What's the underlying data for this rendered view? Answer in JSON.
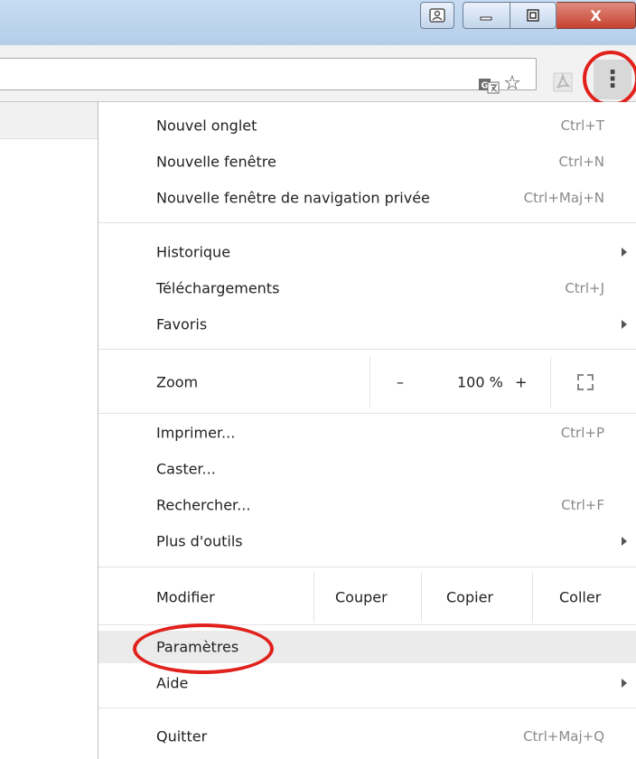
{
  "window": {
    "controls": {
      "profile": "profile-icon",
      "minimize": "minimize-icon",
      "restore": "restore-icon",
      "close": "close-icon",
      "close_glyph": "X"
    }
  },
  "toolbar": {
    "icons": [
      "translate-icon",
      "star-icon",
      "pdf-icon",
      "menu-icon"
    ],
    "star_glyph": "☆",
    "menu_glyph": "⋮"
  },
  "menu": {
    "group1": [
      {
        "label": "Nouvel onglet",
        "shortcut": "Ctrl+T"
      },
      {
        "label": "Nouvelle fenêtre",
        "shortcut": "Ctrl+N"
      },
      {
        "label": "Nouvelle fenêtre de navigation privée",
        "shortcut": "Ctrl+Maj+N"
      }
    ],
    "group2": [
      {
        "label": "Historique",
        "submenu": true
      },
      {
        "label": "Téléchargements",
        "shortcut": "Ctrl+J"
      },
      {
        "label": "Favoris",
        "submenu": true
      }
    ],
    "zoom": {
      "label": "Zoom",
      "minus": "–",
      "value": "100 %",
      "plus": "+"
    },
    "group3": [
      {
        "label": "Imprimer...",
        "shortcut": "Ctrl+P"
      },
      {
        "label": "Caster..."
      },
      {
        "label": "Rechercher...",
        "shortcut": "Ctrl+F"
      },
      {
        "label": "Plus d'outils",
        "submenu": true
      }
    ],
    "edit": {
      "label": "Modifier",
      "cut": "Couper",
      "copy": "Copier",
      "paste": "Coller"
    },
    "group4": [
      {
        "label": "Paramètres",
        "highlighted": true
      },
      {
        "label": "Aide",
        "submenu": true
      }
    ],
    "quit": {
      "label": "Quitter",
      "shortcut": "Ctrl+Maj+Q"
    }
  },
  "colors": {
    "annotation": "#e1211c",
    "highlight": "#ebebeb"
  }
}
